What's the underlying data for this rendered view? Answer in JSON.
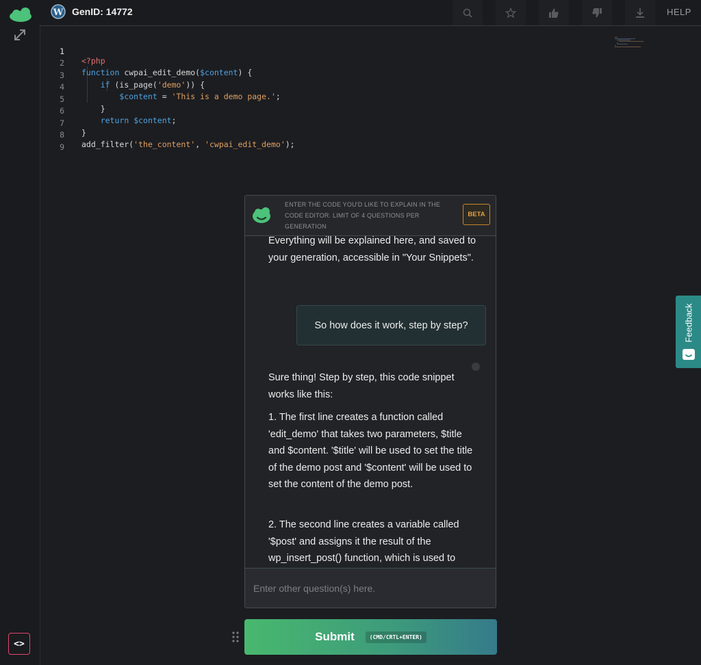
{
  "topbar": {
    "genid": "GenID: 14772",
    "help": "HELP",
    "icons": [
      "search-icon",
      "star-icon",
      "thumbs-up-icon",
      "thumbs-down-icon",
      "download-icon"
    ]
  },
  "editor": {
    "line_numbers": [
      "1",
      "2",
      "3",
      "4",
      "5",
      "6",
      "7",
      "8",
      "9"
    ],
    "lines": [
      "<?php",
      "function cwpai_edit_demo($content) {",
      "    if (is_page('demo')) {",
      "        $content = 'This is a demo page.';",
      "    }",
      "    return $content;",
      "}",
      "add_filter('the_content', 'cwpai_edit_demo');",
      ""
    ]
  },
  "chat": {
    "hint": "ENTER THE CODE YOU'D LIKE TO EXPLAIN IN THE CODE EDITOR. LIMIT OF 4 QUESTIONS PER GENERATION",
    "beta": "BETA",
    "intro": "Everything will be explained here, and saved to your generation, accessible in \"Your Snippets\".",
    "user_question": "So how does it work, step by step?",
    "answer": [
      "Sure thing! Step by step, this code snippet works like this:",
      "1. The first line creates a function called 'edit_demo' that takes two parameters, $title and $content. '$title' will be used to set the title of the demo post and '$content' will be used to set the content of the demo post.",
      "2. The second line creates a variable called '$post' and assigns it the result of the wp_insert_post() function, which is used to"
    ],
    "input_placeholder": "Enter other question(s) here."
  },
  "submit": {
    "label": "Submit",
    "shortcut": "(CMD/CRTL+ENTER)"
  },
  "feedback": "Feedback",
  "colors": {
    "accent_green": "#48b86e",
    "beta_orange": "#e0a040",
    "code_button_border": "#e0466d",
    "feedback_teal": "#2b8a86"
  }
}
